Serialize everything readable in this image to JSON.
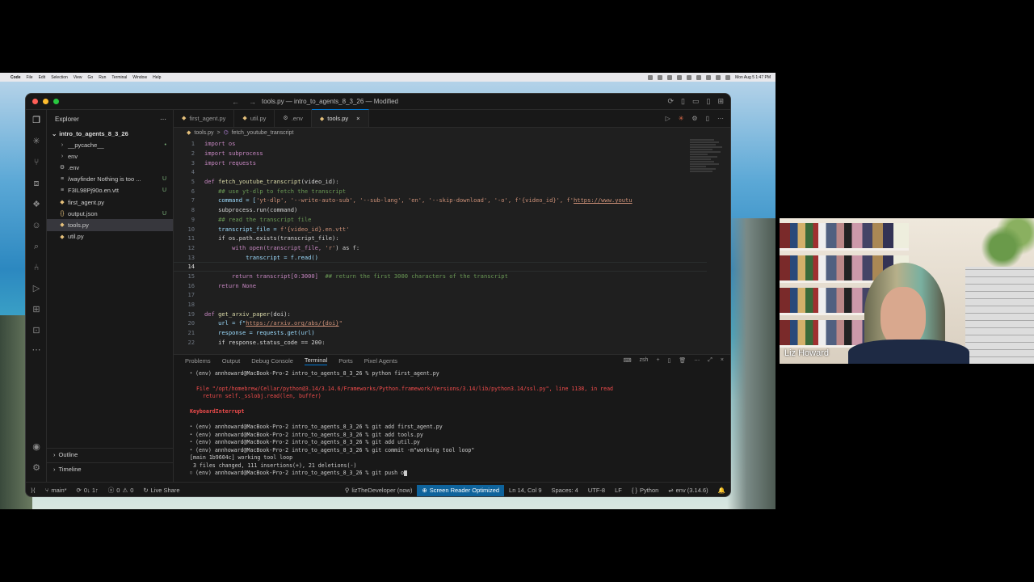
{
  "menubar": {
    "items": [
      "Code",
      "File",
      "Edit",
      "Selection",
      "View",
      "Go",
      "Run",
      "Terminal",
      "Window",
      "Help"
    ],
    "clock": "Mon Aug 5  1:47 PM"
  },
  "window": {
    "title": "tools.py — intro_to_agents_8_3_26 — Modified"
  },
  "sidebar": {
    "header": "Explorer",
    "folder": "intro_to_agents_8_3_26",
    "items": [
      {
        "label": "__pycache__",
        "icon": "chevron-right-icon",
        "badge": "•"
      },
      {
        "label": "env",
        "icon": "chevron-right-icon",
        "badge": ""
      },
      {
        "label": ".env",
        "icon": "gear-icon",
        "badge": ""
      },
      {
        "label": "/wayfinder    Nothing is too ...",
        "icon": "file-icon",
        "badge": "U"
      },
      {
        "label": "F3IL98Pj90o.en.vtt",
        "icon": "file-icon",
        "badge": "U"
      },
      {
        "label": "first_agent.py",
        "icon": "python-icon",
        "badge": ""
      },
      {
        "label": "output.json",
        "icon": "json-icon",
        "badge": "U"
      },
      {
        "label": "tools.py",
        "icon": "python-icon",
        "badge": ""
      },
      {
        "label": "util.py",
        "icon": "python-icon",
        "badge": ""
      }
    ],
    "outline": "Outline",
    "timeline": "Timeline"
  },
  "tabs": [
    {
      "label": "first_agent.py",
      "icon": "python-icon"
    },
    {
      "label": "util.py",
      "icon": "python-icon"
    },
    {
      "label": ".env",
      "icon": "gear-icon"
    },
    {
      "label": "tools.py",
      "icon": "python-icon",
      "close": "×"
    }
  ],
  "breadcrumb": {
    "file": "tools.py",
    "sep": ">",
    "symbol": "fetch_youtube_transcript"
  },
  "code": [
    {
      "n": "1"
    },
    {
      "n": "2"
    },
    {
      "n": "3"
    },
    {
      "n": "4"
    },
    {
      "n": "5"
    },
    {
      "n": "6"
    },
    {
      "n": "7"
    },
    {
      "n": "8"
    },
    {
      "n": "9"
    },
    {
      "n": "10"
    },
    {
      "n": "11"
    },
    {
      "n": "12"
    },
    {
      "n": "13"
    },
    {
      "n": "14"
    },
    {
      "n": "15"
    },
    {
      "n": "16"
    },
    {
      "n": "17"
    },
    {
      "n": "18"
    },
    {
      "n": "19"
    },
    {
      "n": "20"
    },
    {
      "n": "21"
    },
    {
      "n": "22"
    }
  ],
  "code_text": {
    "l1": "import os",
    "l2": "import subprocess",
    "l3": "import requests",
    "l5a": "def ",
    "l5b": "fetch_youtube_transcript",
    "l5c": "(video_id):",
    "l6": "    ## use yt-dlp to fetch the transcript",
    "l7a": "    command = [",
    "l7b": "'yt-dlp', '--write-auto-sub', '--sub-lang', 'en', '--skip-download', '-o', f'{video_id}', f'",
    "l7c": "https://www.youtu",
    "l8": "    subprocess.run(command)",
    "l9": "    ## read the transcript file",
    "l10a": "    transcript_file = ",
    "l10b": "f'{video_id}.en.vtt'",
    "l11": "    if os.path.exists(transcript_file):",
    "l12a": "        with open(transcript_file, ",
    "l12b": "'r'",
    "l12c": ") as f:",
    "l13": "            transcript = f.read()",
    "l15a": "        return transcript[0:3000]  ",
    "l15b": "## return the first 3000 characters of the transcript",
    "l16": "    return None",
    "l19a": "def ",
    "l19b": "get_arxiv_paper",
    "l19c": "(doi):",
    "l20a": "    url = f\"",
    "l20b": "https://arxiv.org/abs/{doi}",
    "l20c": "\"",
    "l21": "    response = requests.get(url)",
    "l22": "    if response.status_code == 200:"
  },
  "panel": {
    "tabs": [
      "Problems",
      "Output",
      "Debug Console",
      "Terminal",
      "Ports",
      "Pixel Agents"
    ],
    "active": "Terminal",
    "shell": "zsh"
  },
  "terminal": {
    "l1": "(env) annhoward@MacBook-Pro-2 intro_to_agents_8_3_26 % python first_agent.py",
    "l2": "  File \"/opt/homebrew/Cellar/python@3.14/3.14.6/Frameworks/Python.framework/Versions/3.14/lib/python3.14/ssl.py\", line 1138, in read",
    "l3": "    return self._sslobj.read(len, buffer)",
    "l4": "KeyboardInterrupt",
    "l5": "(env) annhoward@MacBook-Pro-2 intro_to_agents_8_3_26 % git add first_agent.py",
    "l6": "(env) annhoward@MacBook-Pro-2 intro_to_agents_8_3_26 % git add tools.py",
    "l7": "(env) annhoward@MacBook-Pro-2 intro_to_agents_8_3_26 % git add util.py",
    "l8": "(env) annhoward@MacBook-Pro-2 intro_to_agents_8_3_26 % git commit -m\"working tool loop\"",
    "l9": "[main 1b9604c] working tool loop",
    "l10": " 3 files changed, 111 insertions(+), 21 deletions(-)",
    "l11": "(env) annhoward@MacBook-Pro-2 intro_to_agents_8_3_26 % git push o"
  },
  "statusbar": {
    "branch": "main*",
    "sync": "0↓ 1↑",
    "errors": "0",
    "warnings": "0",
    "live_share": "Live Share",
    "user": "lizTheDeveloper (now)",
    "screen_reader": "Screen Reader Optimized",
    "position": "Ln 14, Col 9",
    "spaces": "Spaces: 4",
    "encoding": "UTF-8",
    "eol": "LF",
    "language": "Python",
    "env": "env (3.14.6)"
  },
  "webcam": {
    "name": "Liz Howard"
  }
}
